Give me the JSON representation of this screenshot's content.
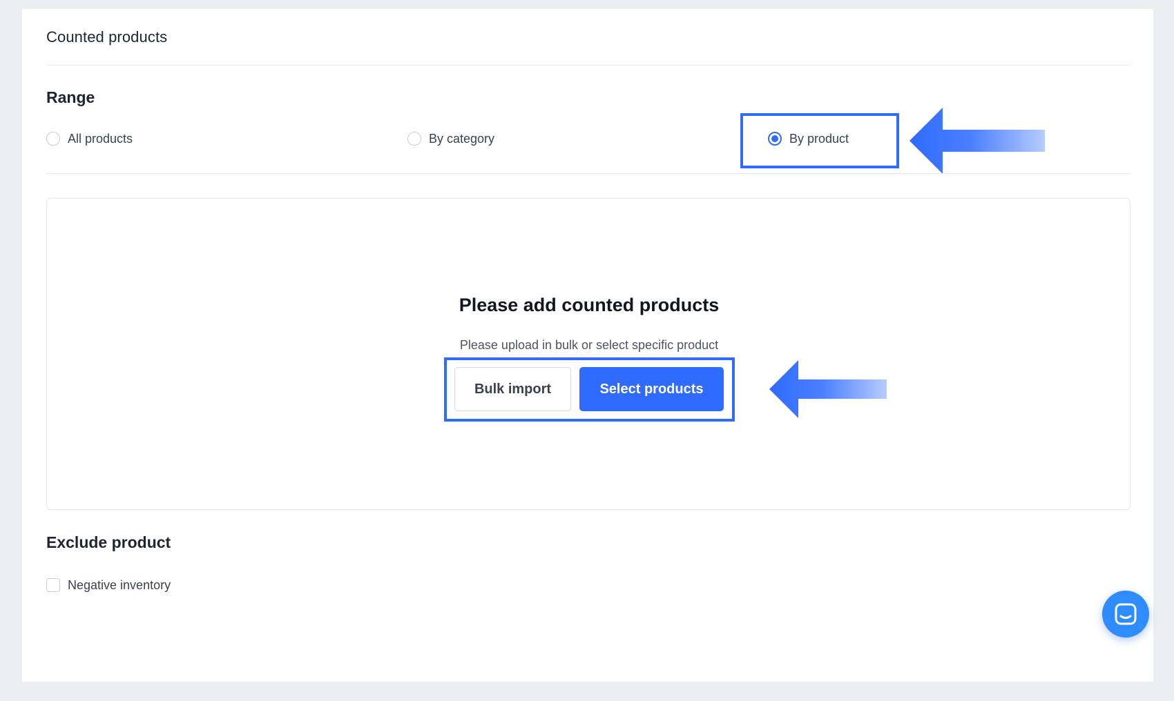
{
  "panel": {
    "title": "Counted products"
  },
  "range": {
    "title": "Range",
    "options": [
      {
        "label": "All products",
        "selected": false
      },
      {
        "label": "By category",
        "selected": false
      },
      {
        "label": "By product",
        "selected": true
      }
    ]
  },
  "empty_state": {
    "title": "Please add counted products",
    "subtitle": "Please upload in bulk or select specific product",
    "bulk_import_label": "Bulk import",
    "select_products_label": "Select products"
  },
  "exclude": {
    "title": "Exclude product",
    "checkbox_label": "Negative inventory",
    "checked": false
  },
  "chat": {
    "icon": "chat-icon"
  },
  "colors": {
    "accent": "#2f6bff",
    "chat": "#2f8cff",
    "background": "#eceef1"
  }
}
